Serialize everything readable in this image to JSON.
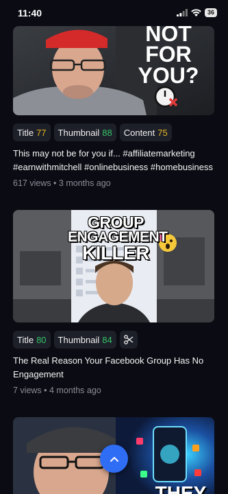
{
  "status_bar": {
    "time": "11:40",
    "battery": "36"
  },
  "colors": {
    "background": "#0b0c13",
    "chip_bg": "#1d1f29",
    "score_yellow": "#e7b822",
    "score_green": "#35c466",
    "fab_blue": "#2f6df5"
  },
  "videos": [
    {
      "thumbnail_text": [
        "NOT",
        "FOR",
        "YOU?"
      ],
      "scores": [
        {
          "label": "Title",
          "value": "77",
          "color": "yellow"
        },
        {
          "label": "Thumbnail",
          "value": "88",
          "color": "green"
        },
        {
          "label": "Content",
          "value": "75",
          "color": "yellow"
        }
      ],
      "title": "This may not be for you if... #affiliatemarketing #earnwithmitchell #onlinebusiness #homebusiness",
      "meta": "617 views • 3 months ago"
    },
    {
      "thumbnail_text": [
        "GROUP",
        "ENGAGEMENT",
        "KILLER"
      ],
      "scores": [
        {
          "label": "Title",
          "value": "80",
          "color": "green"
        },
        {
          "label": "Thumbnail",
          "value": "84",
          "color": "green"
        }
      ],
      "tool_icon": "scissors-icon",
      "title": "The Real Reason Your Facebook Group Has No Engagement",
      "meta": "7 views • 4 months ago"
    },
    {
      "thumbnail_text": [
        "THEY"
      ]
    }
  ],
  "fab": {
    "icon": "chevron-up-icon"
  }
}
